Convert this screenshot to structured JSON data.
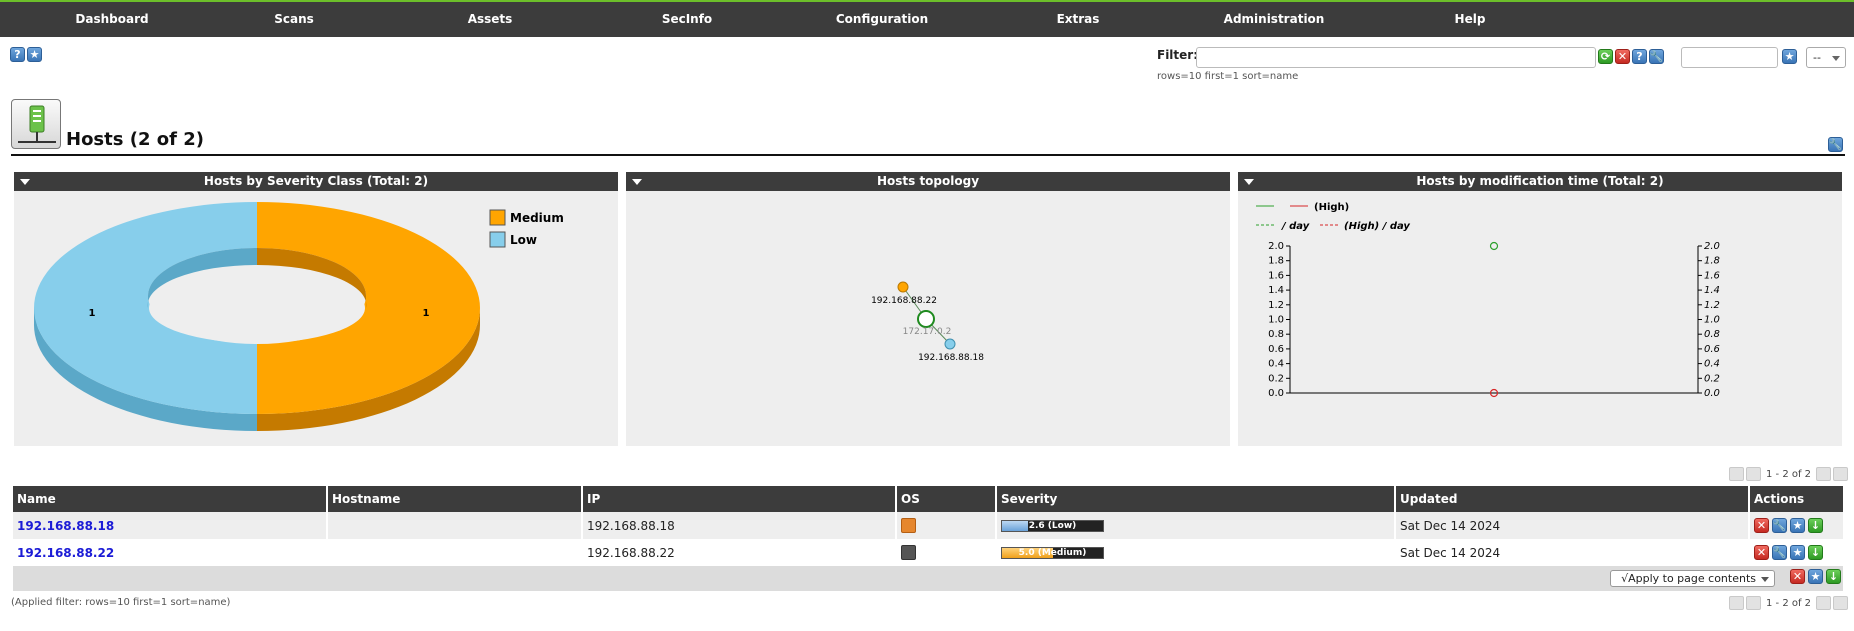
{
  "nav": [
    "Dashboard",
    "Scans",
    "Assets",
    "SecInfo",
    "Configuration",
    "Extras",
    "Administration",
    "Help"
  ],
  "toolbar": {
    "help_icon": "help-icon",
    "new_icon": "star-icon"
  },
  "filter": {
    "label": "Filter:",
    "value": "",
    "info": "rows=10 first=1 sort=name",
    "select_value": "--"
  },
  "page": {
    "title": "Hosts (2 of 2)"
  },
  "panels": {
    "severity": {
      "title": "Hosts by Severity Class (Total: 2)"
    },
    "topology": {
      "title": "Hosts topology"
    },
    "modtime": {
      "title": "Hosts by modification time (Total: 2)"
    }
  },
  "chart_data": [
    {
      "type": "pie",
      "style": "donut-3d",
      "title": "Hosts by Severity Class (Total: 2)",
      "slices": [
        {
          "label": "Medium",
          "value": 1,
          "color": "#ffa500"
        },
        {
          "label": "Low",
          "value": 1,
          "color": "#87ceeb"
        }
      ],
      "legend": [
        "Medium",
        "Low"
      ]
    },
    {
      "type": "line",
      "title": "Hosts by modification time (Total: 2)",
      "legend": [
        "(High)",
        "/ day",
        "(High) / day"
      ],
      "ylim": [
        0,
        2
      ],
      "yticks": [
        "2.0",
        "1.8",
        "1.6",
        "1.4",
        "1.2",
        "1.0",
        "0.8",
        "0.6",
        "0.4",
        "0.2",
        "0.0"
      ],
      "y2ticks": [
        "2.0",
        "1.8",
        "1.6",
        "1.4",
        "1.2",
        "1.0",
        "0.8",
        "0.6",
        "0.4",
        "0.2",
        "0.0"
      ],
      "series": [
        {
          "name": "/ day",
          "color": "#2ca02c",
          "values": [
            2
          ]
        },
        {
          "name": "(High)",
          "color": "#d62728",
          "values": [
            0
          ]
        }
      ]
    }
  ],
  "topology": {
    "nodes": [
      {
        "label": "192.168.88.22",
        "color": "#ffa500"
      },
      {
        "label": "172.17.0.2",
        "color": "#ffffff"
      },
      {
        "label": "192.168.88.18",
        "color": "#87ceeb"
      }
    ]
  },
  "pager": {
    "text": "1 - 2 of 2"
  },
  "table": {
    "headers": [
      "Name",
      "Hostname",
      "IP",
      "OS",
      "Severity",
      "Updated",
      "Actions"
    ],
    "rows": [
      {
        "name": "192.168.88.18",
        "hostname": "",
        "ip": "192.168.88.18",
        "os_icon": "ubuntu-os-icon",
        "severity": "2.6 (Low)",
        "severity_value": 2.6,
        "severity_color": "#87ceeb",
        "updated": "Sat Dec 14 2024"
      },
      {
        "name": "192.168.88.22",
        "hostname": "",
        "ip": "192.168.88.22",
        "os_icon": "linux-os-icon",
        "severity": "5.0 (Medium)",
        "severity_value": 5.0,
        "severity_color": "#ffa500",
        "updated": "Sat Dec 14 2024"
      }
    ],
    "apply_label": "√Apply to page contents"
  },
  "applied_filter": "(Applied filter: rows=10 first=1 sort=name)"
}
